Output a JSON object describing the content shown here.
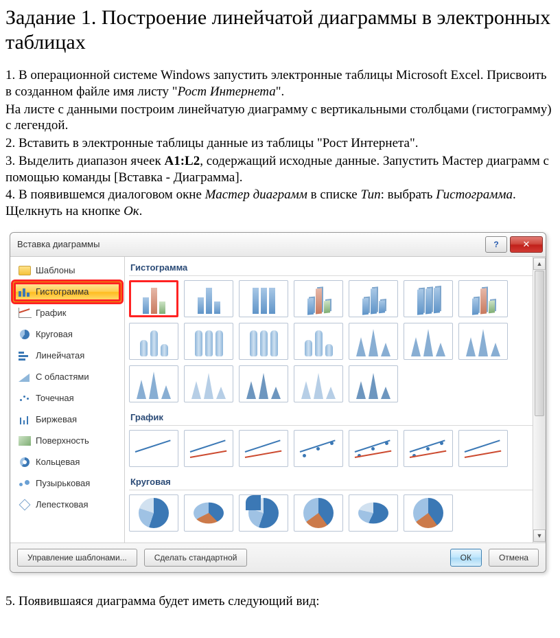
{
  "heading": "Задание 1. Построение линейчатой диаграммы в электронных таблицах",
  "para1a": "1. В операционной системе Windows запустить электронные таблицы Microsoft Excel. Присвоить в созданном файле имя листу \"",
  "para1_italic": "Рост Интернета",
  "para1b": "\".",
  "para1c": "На листе с данными построим линейчатую диаграмму с вертикальными столбцами (гистограмму) с легендой.",
  "para2": "2. Вставить в электронные таблицы данные из таблицы \"Рост Интернета\".",
  "para3a": "3. Выделить диапазон ячеек ",
  "para3_bold": "A1:L2",
  "para3b": ", содержащий исходные данные. Запустить Мастер диаграмм с помощью команды [Вставка - Диаграмма].",
  "para4a": "4. В появившемся диалоговом окне ",
  "para4_i1": "Мастер диаграмм",
  "para4b": " в списке ",
  "para4_i2": "Тип",
  "para4c": ": выбрать ",
  "para4_i3": "Гистограмма",
  "para4d": ". Щелкнуть на кнопке ",
  "para4_i4": "Ок",
  "para4e": ".",
  "para5": "5. Появившаяся диаграмма будет иметь следующий вид:",
  "dialog": {
    "title": "Вставка диаграммы",
    "help": "?",
    "close": "✕",
    "sidebar": [
      "Шаблоны",
      "Гистограмма",
      "График",
      "Круговая",
      "Линейчатая",
      "С областями",
      "Точечная",
      "Биржевая",
      "Поверхность",
      "Кольцевая",
      "Пузырьковая",
      "Лепестковая"
    ],
    "groups": {
      "g1": "Гистограмма",
      "g2": "График",
      "g3": "Круговая"
    },
    "buttons": {
      "templates": "Управление шаблонами...",
      "default": "Сделать стандартной",
      "ok": "ОК",
      "cancel": "Отмена"
    }
  }
}
